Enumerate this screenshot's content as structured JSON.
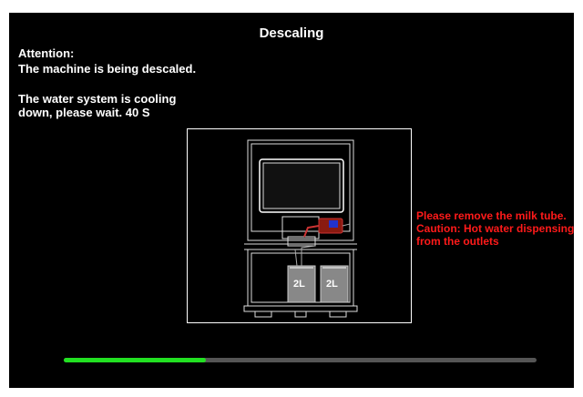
{
  "header": {
    "title": "Descaling"
  },
  "status": {
    "attention_label": "Attention:",
    "descaling_message": "The machine is being descaled.",
    "cooling_message": "The water system is cooling down, please wait. 40 S"
  },
  "illustration": {
    "tank_left_label": "2L",
    "tank_right_label": "2L"
  },
  "warning": {
    "text": "Please remove the milk tube. Caution: Hot water dispensing from the outlets"
  },
  "progress": {
    "fraction": 0.3
  },
  "colors": {
    "warning": "#ff1a1a",
    "progress_fill": "#22e022",
    "progress_track": "#555555"
  }
}
